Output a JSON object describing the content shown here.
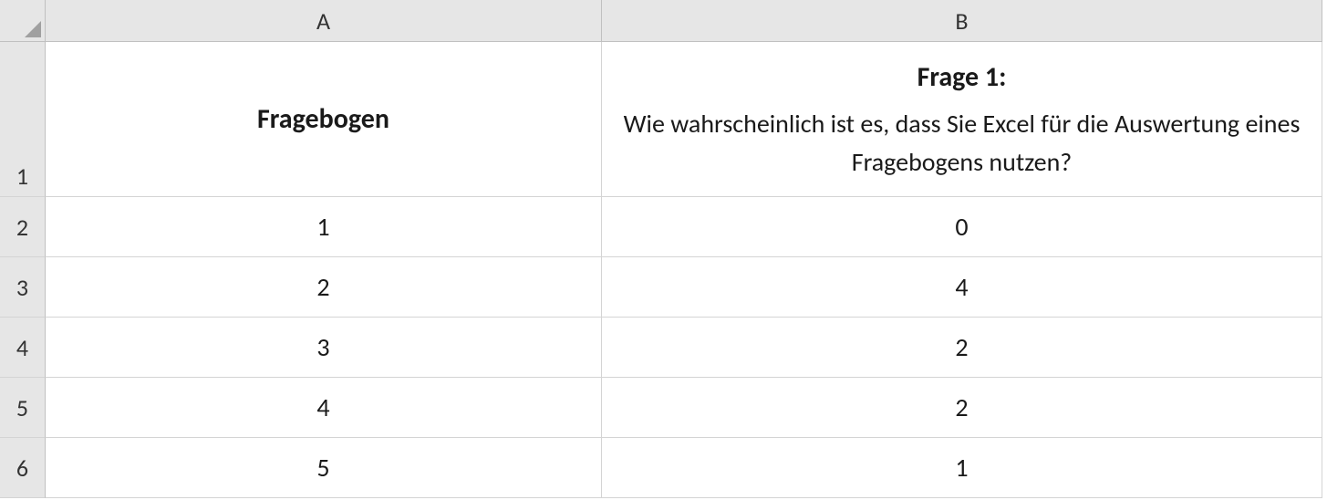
{
  "columns": {
    "A": "A",
    "B": "B"
  },
  "row_numbers": [
    "1",
    "2",
    "3",
    "4",
    "5",
    "6"
  ],
  "cells": {
    "A1": "Fragebogen",
    "B1_title": "Frage 1:",
    "B1_text": "Wie wahrscheinlich ist es, dass Sie Excel für die Auswertung eines Fragebogens nutzen?",
    "A2": "1",
    "B2": "0",
    "A3": "2",
    "B3": "4",
    "A4": "3",
    "B4": "2",
    "A5": "4",
    "B5": "2",
    "A6": "5",
    "B6": "1"
  }
}
